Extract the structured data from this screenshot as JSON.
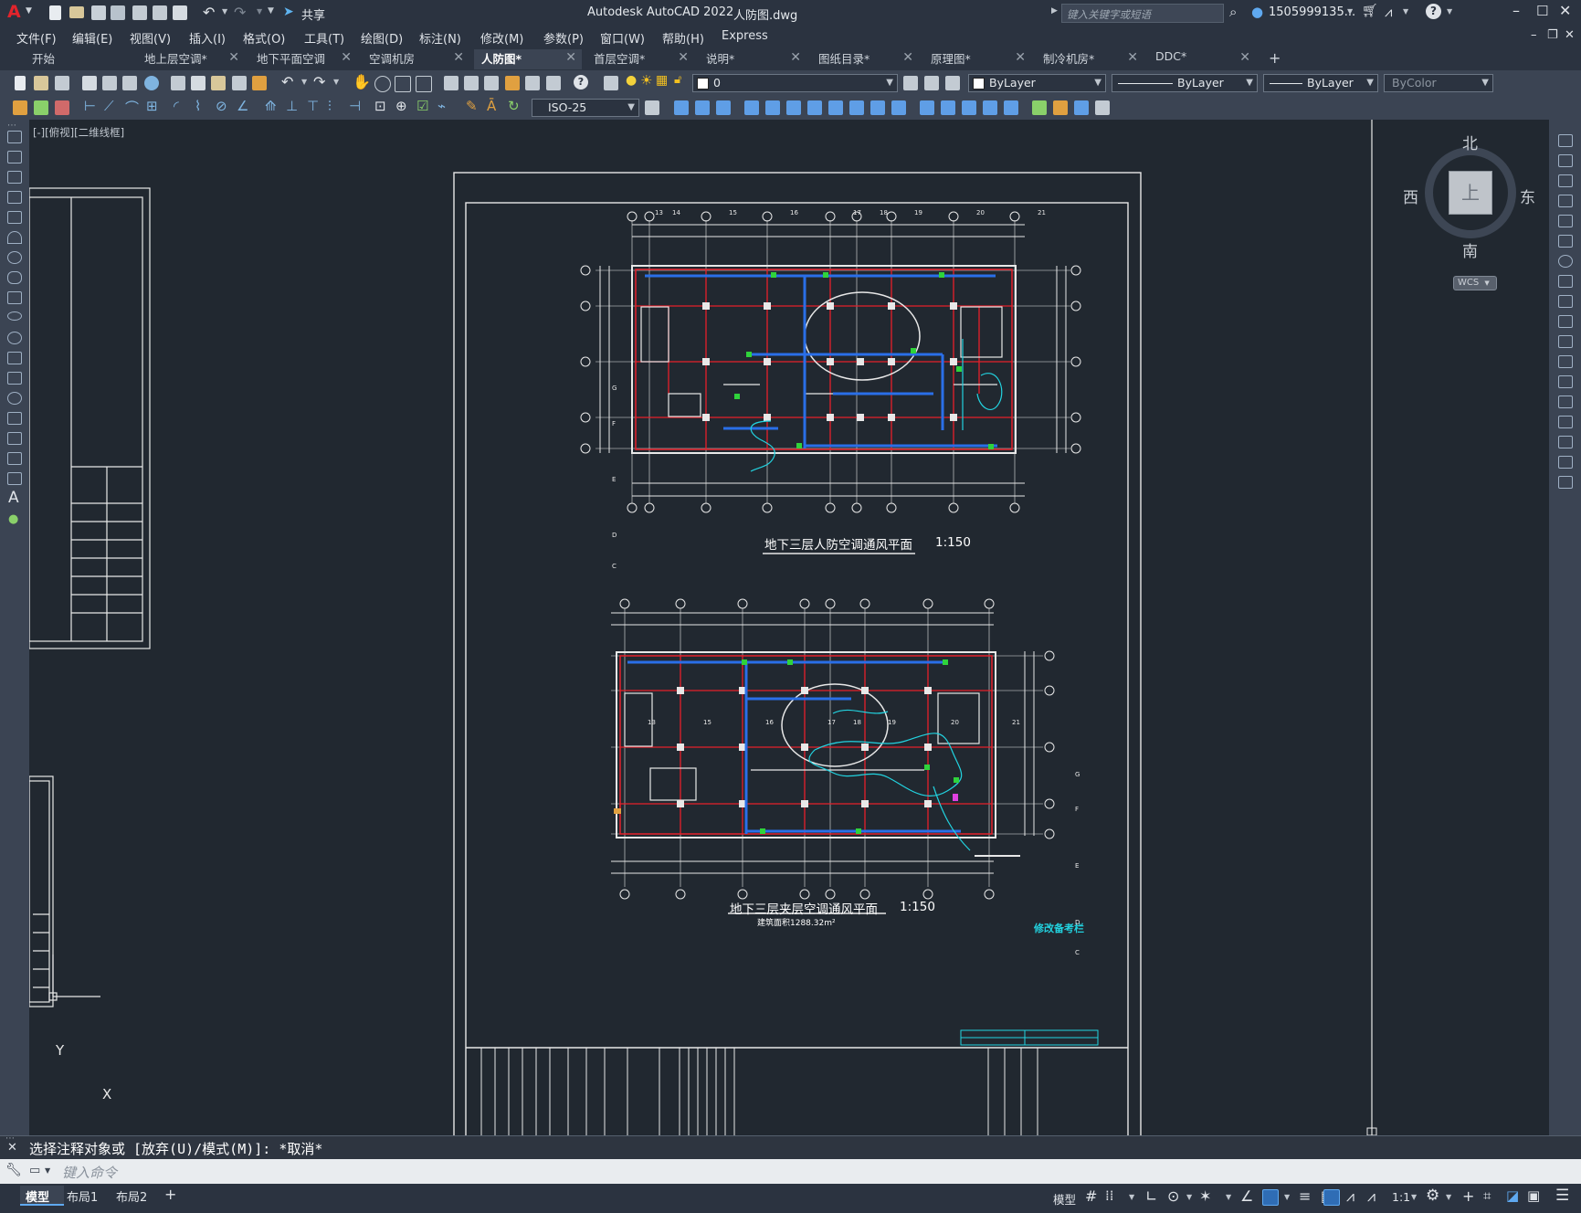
{
  "app": {
    "title": "Autodesk AutoCAD 2022",
    "filename": "人防图.dwg",
    "share_label": "共享",
    "search_placeholder": "键入关键字或短语",
    "user": "1505999135...",
    "logo": "A"
  },
  "menu": [
    "文件(F)",
    "编辑(E)",
    "视图(V)",
    "插入(I)",
    "格式(O)",
    "工具(T)",
    "绘图(D)",
    "标注(N)",
    "修改(M)",
    "参数(P)",
    "窗口(W)",
    "帮助(H)",
    "Express"
  ],
  "tabs": [
    {
      "label": "开始"
    },
    {
      "label": "地上层空调*"
    },
    {
      "label": "地下平面空调"
    },
    {
      "label": "空调机房"
    },
    {
      "label": "人防图*",
      "active": true
    },
    {
      "label": "首层空调*"
    },
    {
      "label": "说明*"
    },
    {
      "label": "图纸目录*"
    },
    {
      "label": "原理图*"
    },
    {
      "label": "制冷机房*"
    },
    {
      "label": "DDC*"
    }
  ],
  "toolbar": {
    "layer_value": "0",
    "color_value": "ByLayer",
    "linetype_value": "ByLayer",
    "lineweight_value": "ByLayer",
    "plotstyle_value": "ByColor",
    "dimstyle_value": "ISO-25"
  },
  "viewport": {
    "label": "[-][俯视][二维线框]",
    "viewcube": {
      "north": "北",
      "south": "南",
      "east": "东",
      "west": "西",
      "top": "上",
      "wcs": "WCS"
    },
    "ucs": {
      "x": "X",
      "y": "Y"
    }
  },
  "drawing": {
    "plan1_title": "地下三层人防空调通风平面",
    "plan1_scale": "1:150",
    "plan2_title": "地下三层夹层空调通风平面",
    "plan2_scale": "1:150",
    "plan2_area": "建筑面积1288.32m²",
    "revision_title": "修改备考栏",
    "plan1_top_axes": [
      "13",
      "14",
      "15",
      "16",
      "17",
      "18",
      "19",
      "20",
      "21"
    ],
    "plan1_side_axes": [
      "G",
      "F",
      "E",
      "D",
      "C"
    ],
    "plan2_top_axes": [
      "13",
      "15",
      "16",
      "17",
      "18",
      "19",
      "20",
      "21"
    ],
    "plan2_side_axes": [
      "G",
      "F",
      "E",
      "D",
      "C"
    ]
  },
  "command": {
    "history": "选择注释对象或 [放弃(U)/模式(M)]: *取消*",
    "placeholder": "键入命令"
  },
  "status": {
    "layout_tabs": [
      "模型",
      "布局1",
      "布局2"
    ],
    "model_label": "模型",
    "scale": "1:1"
  },
  "colors": {
    "canvas_bg": "#212830",
    "wall_red": "#e6202a",
    "duct_blue": "#2a6fe8",
    "pipe_cyan": "#22d3e0",
    "equipment_green": "#2fd33b",
    "border_white": "#e8e8e8"
  }
}
